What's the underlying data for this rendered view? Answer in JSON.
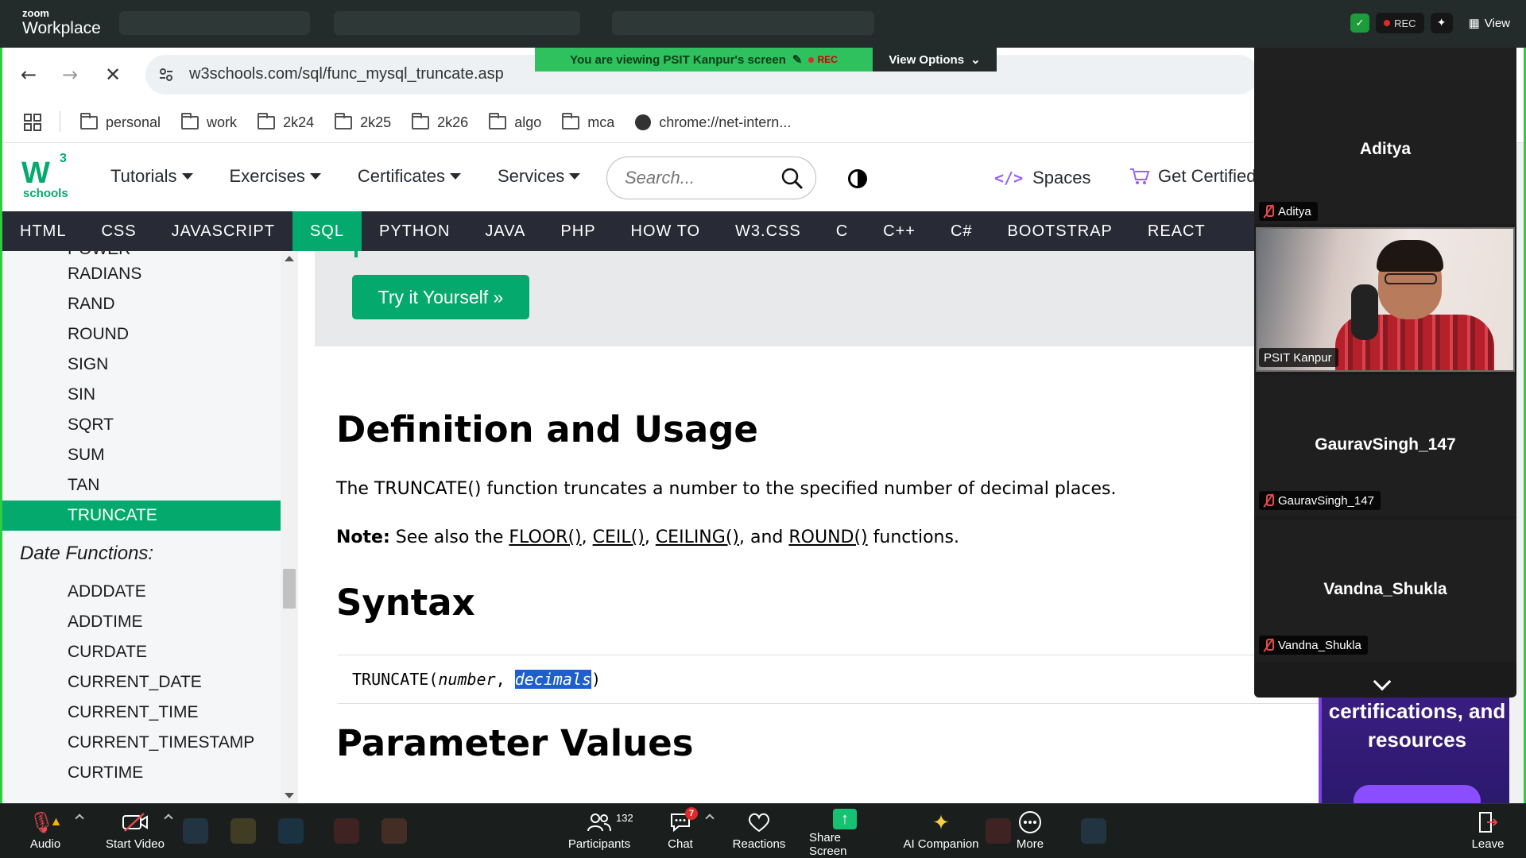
{
  "zoom": {
    "brand_line1": "zoom",
    "brand_line2": "Workplace",
    "rec_label": "REC",
    "view_label": "View",
    "viewing_banner": "You are viewing  PSIT Kanpur's screen",
    "banner_rec": "REC",
    "view_options_label": "View Options"
  },
  "browser": {
    "url": "w3schools.com/sql/func_mysql_truncate.asp",
    "bookmarks": [
      {
        "label": "personal",
        "icon": "folder-icon"
      },
      {
        "label": "work",
        "icon": "folder-icon"
      },
      {
        "label": "2k24",
        "icon": "folder-icon"
      },
      {
        "label": "2k25",
        "icon": "folder-icon"
      },
      {
        "label": "2k26",
        "icon": "folder-icon"
      },
      {
        "label": "algo",
        "icon": "folder-icon"
      },
      {
        "label": "mca",
        "icon": "folder-icon"
      },
      {
        "label": "chrome://net-intern...",
        "icon": "globe-icon"
      }
    ]
  },
  "w3": {
    "logo_text": "W",
    "logo_sup": "3",
    "logo_sub": "schools",
    "menu": [
      "Tutorials",
      "Exercises",
      "Certificates",
      "Services"
    ],
    "search_placeholder": "Search...",
    "spaces_label": "Spaces",
    "spaces_code": "</>",
    "get_certified_label": "Get Certified",
    "topnav": [
      "HTML",
      "CSS",
      "JAVASCRIPT",
      "SQL",
      "PYTHON",
      "JAVA",
      "PHP",
      "HOW TO",
      "W3.CSS",
      "C",
      "C++",
      "C#",
      "BOOTSTRAP",
      "REACT"
    ],
    "topnav_active": "SQL",
    "accent": "#04aa6d"
  },
  "sidebar": {
    "items_top": [
      "POWER",
      "RADIANS",
      "RAND",
      "ROUND",
      "SIGN",
      "SIN",
      "SQRT",
      "SUM",
      "TAN",
      "TRUNCATE"
    ],
    "active_item": "TRUNCATE",
    "date_heading": "Date Functions:",
    "date_items": [
      "ADDDATE",
      "ADDTIME",
      "CURDATE",
      "CURRENT_DATE",
      "CURRENT_TIME",
      "CURRENT_TIMESTAMP",
      "CURTIME"
    ]
  },
  "main": {
    "try_button": "Try it Yourself »",
    "def_heading": "Definition and Usage",
    "def_text": "The TRUNCATE() function truncates a number to the specified number of decimal places.",
    "note_label": "Note:",
    "note_pre": " See also the ",
    "note_links": [
      "FLOOR()",
      "CEIL()",
      "CEILING()",
      "ROUND()"
    ],
    "note_sep1": ", ",
    "note_sep2": ", ",
    "note_sep3": ", and ",
    "note_post": " functions.",
    "syntax_heading": "Syntax",
    "code_fn": "TRUNCATE(",
    "code_arg1": "number",
    "code_comma": ", ",
    "code_arg2": "decimals",
    "code_close": ")",
    "param_heading": "Parameter Values"
  },
  "ad": {
    "text": "to all courses, certifications, and resources"
  },
  "participants_panel": {
    "tiles": [
      {
        "name": "Aditya",
        "tag": "Aditya"
      },
      {
        "name": "",
        "tag": "PSIT Kanpur"
      },
      {
        "name": "GauravSingh_147",
        "tag": "GauravSingh_147"
      },
      {
        "name": "Vandna_Shukla",
        "tag": "Vandna_Shukla"
      }
    ]
  },
  "controls": {
    "audio": "Audio",
    "start_video": "Start Video",
    "participants": "Participants",
    "participants_count": "132",
    "chat": "Chat",
    "chat_badge": "7",
    "reactions": "Reactions",
    "share_screen": "Share Screen",
    "ai_companion": "AI Companion",
    "more": "More",
    "leave": "Leave"
  }
}
